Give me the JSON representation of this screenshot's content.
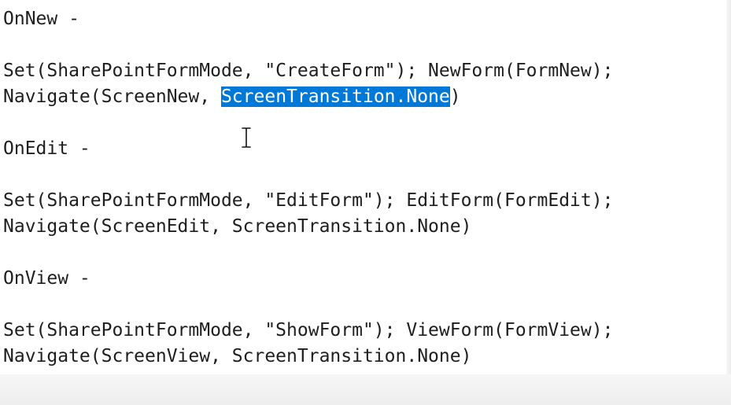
{
  "editor": {
    "lines": [
      {
        "text": "OnNew -"
      },
      {
        "text": "Set(SharePointFormMode, \"CreateForm\"); NewForm(FormNew);"
      },
      {
        "before": "Navigate(ScreenNew, ",
        "selected": "ScreenTransition.None",
        "after": ")"
      },
      {
        "text": "OnEdit -"
      },
      {
        "text": "Set(SharePointFormMode, \"EditForm\"); EditForm(FormEdit);"
      },
      {
        "text": "Navigate(ScreenEdit, ScreenTransition.None)"
      },
      {
        "text": "OnView -"
      },
      {
        "text": "Set(SharePointFormMode, \"ShowForm\"); ViewForm(FormView);"
      },
      {
        "text": "Navigate(ScreenView, ScreenTransition.None)"
      }
    ],
    "selection_color": "#0078d7",
    "cursor": "i-beam-cursor-icon"
  }
}
